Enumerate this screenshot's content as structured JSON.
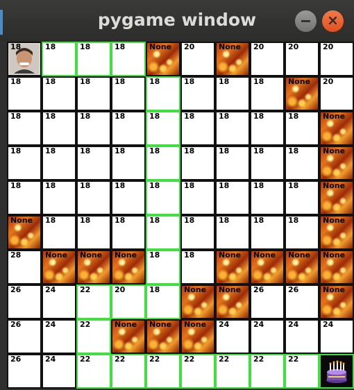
{
  "window": {
    "title": "pygame window"
  },
  "icons": {
    "minimize": "minimize-icon",
    "close": "close-icon",
    "close_glyph": "×"
  },
  "colors": {
    "visited_border": "#3ee03e",
    "default_border": "#111111",
    "close_button": "#e95420"
  },
  "grid": {
    "rows": [
      [
        {
          "v": "18",
          "t": "player"
        },
        {
          "v": "18",
          "g": 1
        },
        {
          "v": "18",
          "g": 1
        },
        {
          "v": "18",
          "g": 1
        },
        {
          "v": "None",
          "t": "fire"
        },
        {
          "v": "20"
        },
        {
          "v": "None",
          "t": "fire"
        },
        {
          "v": "20"
        },
        {
          "v": "20"
        },
        {
          "v": "20"
        }
      ],
      [
        {
          "v": "18"
        },
        {
          "v": "18"
        },
        {
          "v": "18"
        },
        {
          "v": "18"
        },
        {
          "v": "18",
          "g": 1
        },
        {
          "v": "18"
        },
        {
          "v": "18"
        },
        {
          "v": "18"
        },
        {
          "v": "None",
          "t": "fire"
        },
        {
          "v": "20"
        }
      ],
      [
        {
          "v": "18"
        },
        {
          "v": "18"
        },
        {
          "v": "18"
        },
        {
          "v": "18"
        },
        {
          "v": "18",
          "g": 1
        },
        {
          "v": "18"
        },
        {
          "v": "18"
        },
        {
          "v": "18"
        },
        {
          "v": "18"
        },
        {
          "v": "None",
          "t": "fire"
        }
      ],
      [
        {
          "v": "18"
        },
        {
          "v": "18"
        },
        {
          "v": "18"
        },
        {
          "v": "18"
        },
        {
          "v": "18",
          "g": 1
        },
        {
          "v": "18"
        },
        {
          "v": "18"
        },
        {
          "v": "18"
        },
        {
          "v": "18"
        },
        {
          "v": "None",
          "t": "fire"
        }
      ],
      [
        {
          "v": "18"
        },
        {
          "v": "18"
        },
        {
          "v": "18"
        },
        {
          "v": "18"
        },
        {
          "v": "18",
          "g": 1
        },
        {
          "v": "18"
        },
        {
          "v": "18"
        },
        {
          "v": "18"
        },
        {
          "v": "18"
        },
        {
          "v": "None",
          "t": "fire"
        }
      ],
      [
        {
          "v": "None",
          "t": "fire"
        },
        {
          "v": "18"
        },
        {
          "v": "18"
        },
        {
          "v": "18"
        },
        {
          "v": "18",
          "g": 1
        },
        {
          "v": "18"
        },
        {
          "v": "18"
        },
        {
          "v": "18"
        },
        {
          "v": "18"
        },
        {
          "v": "None",
          "t": "fire"
        }
      ],
      [
        {
          "v": "28"
        },
        {
          "v": "None",
          "t": "fire"
        },
        {
          "v": "None",
          "t": "fire"
        },
        {
          "v": "None",
          "t": "fire"
        },
        {
          "v": "18",
          "g": 1
        },
        {
          "v": "18"
        },
        {
          "v": "None",
          "t": "fire"
        },
        {
          "v": "None",
          "t": "fire"
        },
        {
          "v": "None",
          "t": "fire"
        },
        {
          "v": "None",
          "t": "fire"
        }
      ],
      [
        {
          "v": "26"
        },
        {
          "v": "24"
        },
        {
          "v": "22",
          "g": 1
        },
        {
          "v": "20",
          "g": 1
        },
        {
          "v": "18",
          "g": 1
        },
        {
          "v": "None",
          "t": "fire"
        },
        {
          "v": "None",
          "t": "fire"
        },
        {
          "v": "26"
        },
        {
          "v": "26"
        },
        {
          "v": "None",
          "t": "fire"
        }
      ],
      [
        {
          "v": "26"
        },
        {
          "v": "24"
        },
        {
          "v": "22",
          "g": 1
        },
        {
          "v": "None",
          "t": "fire"
        },
        {
          "v": "None",
          "t": "fire"
        },
        {
          "v": "None",
          "t": "fire"
        },
        {
          "v": "24"
        },
        {
          "v": "24"
        },
        {
          "v": "24"
        },
        {
          "v": "24"
        }
      ],
      [
        {
          "v": "26"
        },
        {
          "v": "24"
        },
        {
          "v": "22",
          "g": 1
        },
        {
          "v": "22",
          "g": 1
        },
        {
          "v": "22",
          "g": 1
        },
        {
          "v": "22",
          "g": 1
        },
        {
          "v": "22",
          "g": 1
        },
        {
          "v": "22",
          "g": 1
        },
        {
          "v": "22",
          "g": 1
        },
        {
          "v": "",
          "t": "goal",
          "g": 1
        }
      ]
    ]
  }
}
